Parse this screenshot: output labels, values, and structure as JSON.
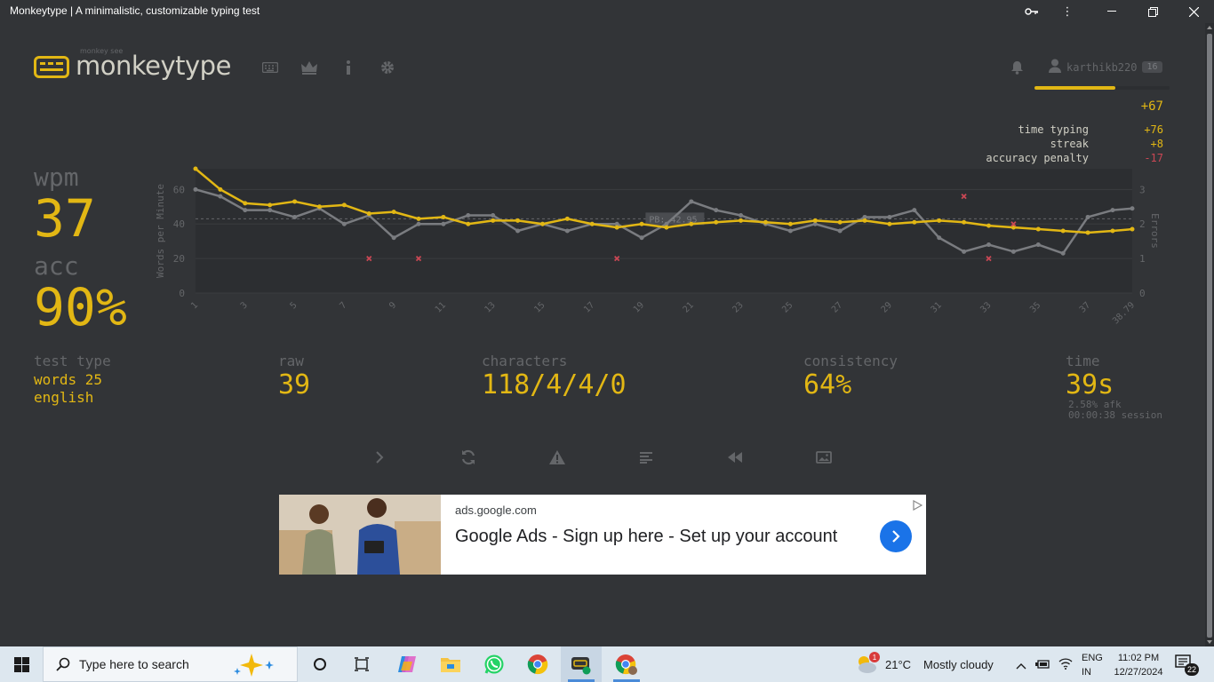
{
  "window": {
    "title": "Monkeytype | A minimalistic, customizable typing test"
  },
  "header": {
    "logo_top": "monkey see",
    "logo_text": "monkeytype",
    "username": "karthikb220",
    "level": "16"
  },
  "xp": {
    "total": "+67",
    "rows": [
      {
        "label": "time typing",
        "value": "+76"
      },
      {
        "label": "streak",
        "value": "+8"
      },
      {
        "label": "accuracy penalty",
        "value": "-17"
      }
    ]
  },
  "result": {
    "wpm_label": "wpm",
    "wpm": "37",
    "acc_label": "acc",
    "acc": "90%",
    "test_type_label": "test type",
    "test_type_mode": "words 25",
    "test_type_lang": "english",
    "raw_label": "raw",
    "raw": "39",
    "characters_label": "characters",
    "characters": "118/4/4/0",
    "consistency_label": "consistency",
    "consistency": "64%",
    "time_label": "time",
    "time": "39s",
    "afk": "2.58% afk",
    "session": "00:00:38 session"
  },
  "chart_data": {
    "type": "line",
    "ylabel": "Words per Minute",
    "y2label": "Errors",
    "ylim": [
      0,
      72
    ],
    "y2lim": [
      0,
      3.6
    ],
    "yticks": [
      0,
      20,
      40,
      60
    ],
    "y2ticks": [
      0,
      1,
      2,
      3
    ],
    "pb_label": "PB: 42.95",
    "pb_value": 43,
    "x": [
      1,
      2,
      3,
      4,
      5,
      6,
      7,
      8,
      9,
      10,
      11,
      12,
      13,
      14,
      15,
      16,
      17,
      18,
      19,
      20,
      21,
      22,
      23,
      24,
      25,
      26,
      27,
      28,
      29,
      30,
      31,
      32,
      33,
      34,
      35,
      36,
      37,
      38,
      38.79
    ],
    "xtick_labels": [
      "1",
      "3",
      "5",
      "7",
      "9",
      "11",
      "13",
      "15",
      "17",
      "19",
      "21",
      "23",
      "25",
      "27",
      "29",
      "31",
      "33",
      "35",
      "37",
      "38.79"
    ],
    "series": [
      {
        "name": "wpm",
        "color": "#e2b714",
        "values": [
          72,
          60,
          52,
          51,
          53,
          50,
          51,
          46,
          47,
          43,
          44,
          40,
          42,
          42,
          40,
          43,
          40,
          38,
          40,
          38,
          40,
          41,
          42,
          41,
          40,
          42,
          41,
          42,
          40,
          41,
          42,
          41,
          39,
          38,
          37,
          36,
          35,
          36,
          37
        ]
      },
      {
        "name": "raw",
        "color": "#7a7c80",
        "values": [
          60,
          56,
          48,
          48,
          44,
          49,
          40,
          45,
          32,
          40,
          40,
          45,
          45,
          36,
          40,
          36,
          40,
          40,
          32,
          40,
          53,
          48,
          45,
          40,
          36,
          40,
          36,
          44,
          44,
          48,
          32,
          24,
          28,
          24,
          28,
          23,
          44,
          48,
          49
        ]
      },
      {
        "name": "errors",
        "color": "#ca4754",
        "points": [
          [
            8,
            1
          ],
          [
            10,
            1
          ],
          [
            18,
            1
          ],
          [
            32,
            2.8
          ],
          [
            33,
            1
          ],
          [
            34,
            2
          ]
        ]
      }
    ]
  },
  "actions": [
    "next-test",
    "repeat-test",
    "report-test",
    "word-history",
    "watch-replay",
    "save-screenshot"
  ],
  "ad": {
    "domain": "ads.google.com",
    "headline": "Google Ads - Sign up here - Set up your account"
  },
  "taskbar": {
    "search_placeholder": "Type here to search",
    "weather_temp": "21°C",
    "weather_desc": "Mostly cloudy",
    "weather_badge": "1",
    "lang1": "ENG",
    "lang2": "IN",
    "time": "11:02 PM",
    "date": "12/27/2024",
    "notifications": "22"
  }
}
